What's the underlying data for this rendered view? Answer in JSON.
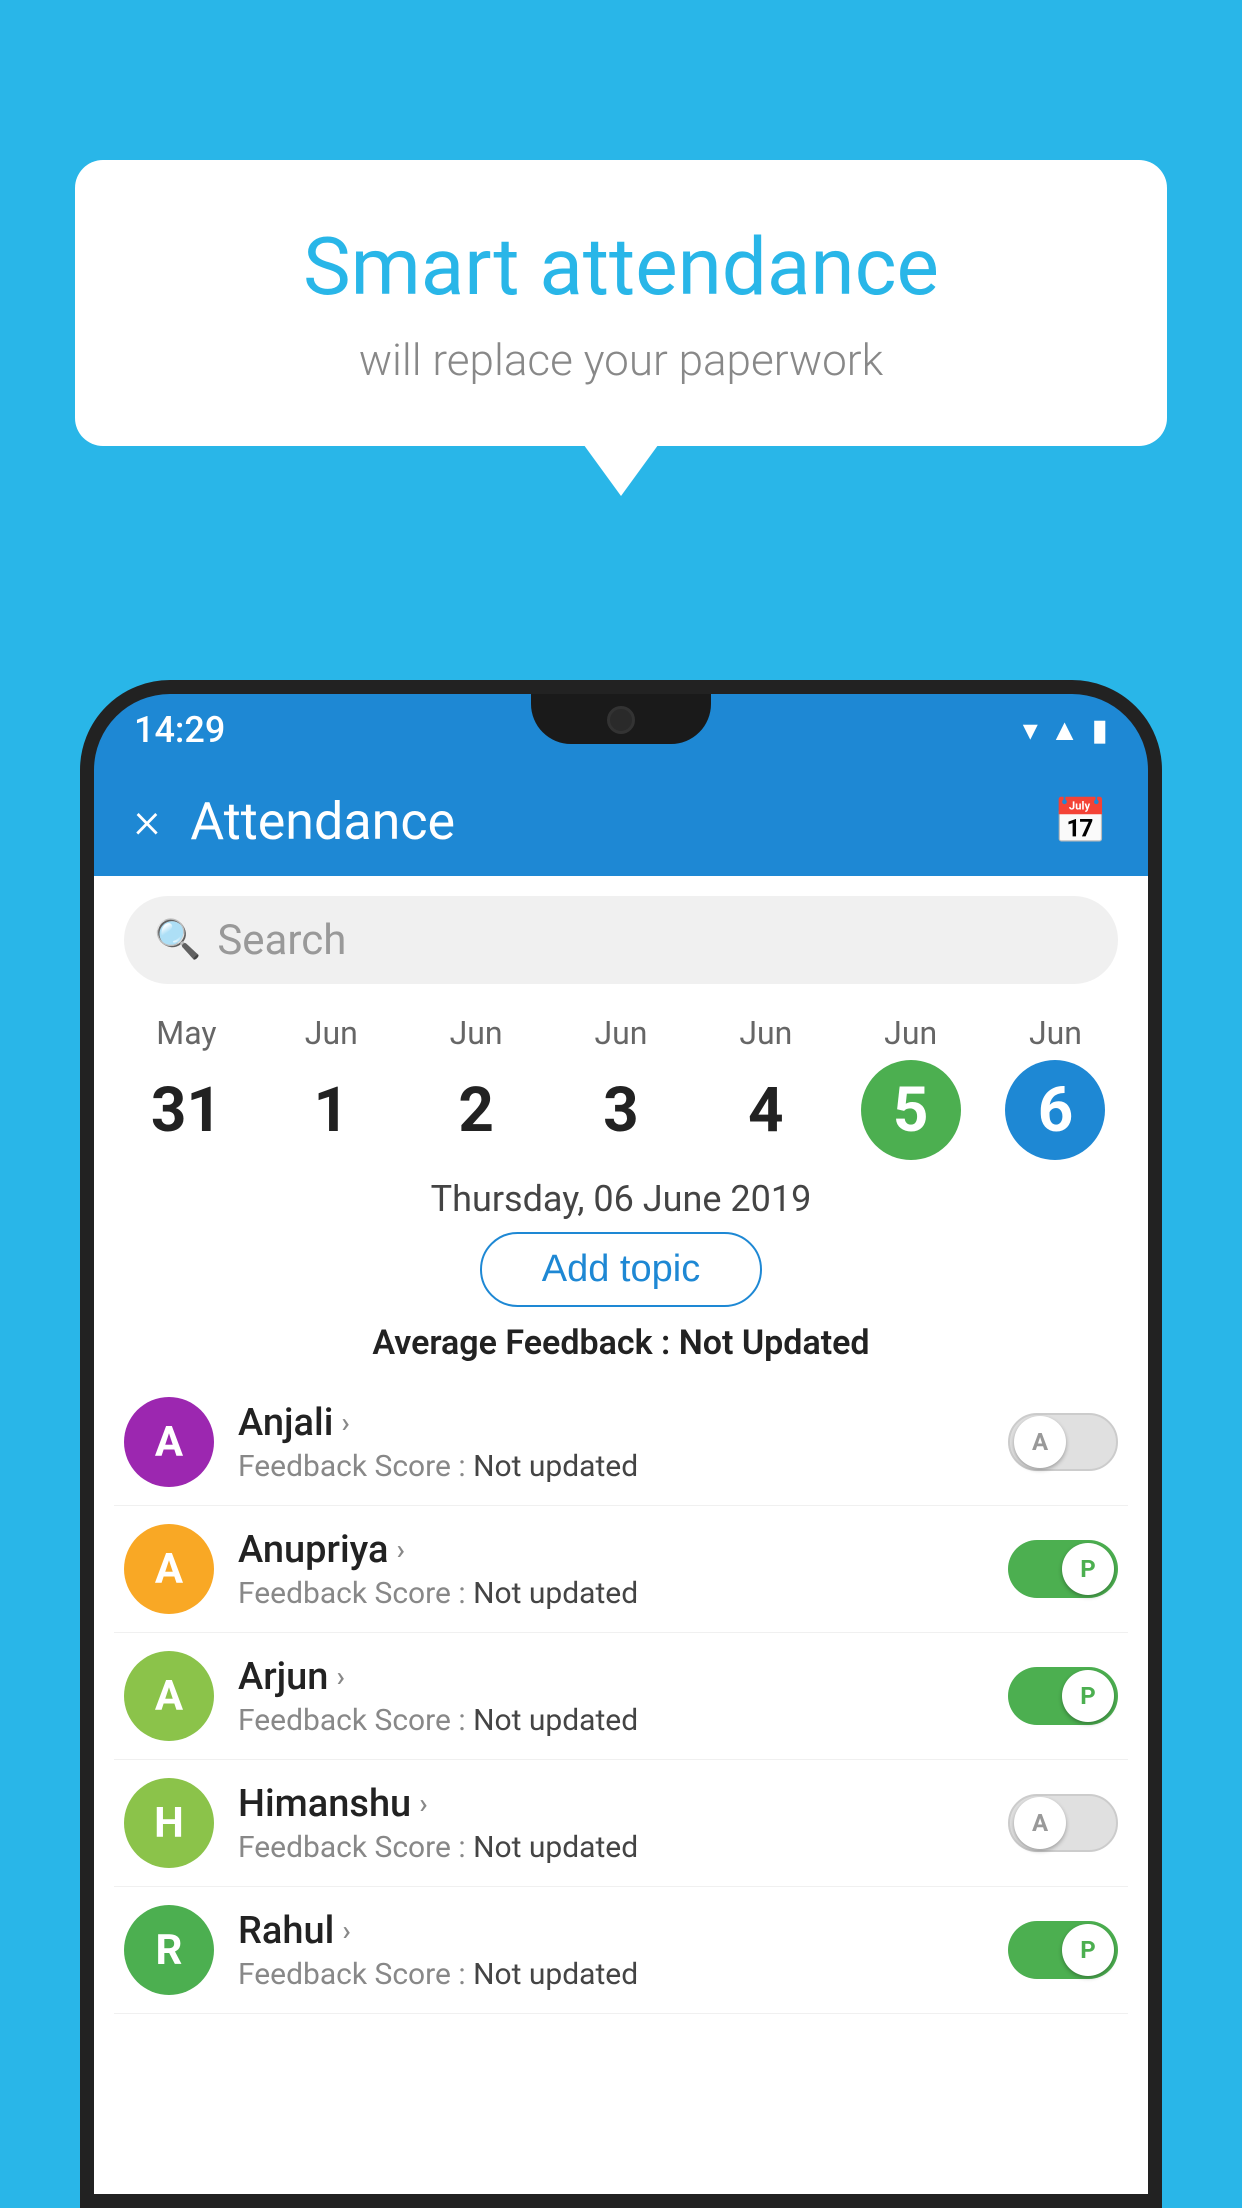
{
  "background_color": "#29b6e8",
  "speech_bubble": {
    "title": "Smart attendance",
    "subtitle": "will replace your paperwork"
  },
  "status_bar": {
    "time": "14:29",
    "icons": [
      "wifi",
      "signal",
      "battery"
    ]
  },
  "app_bar": {
    "title": "Attendance",
    "close_label": "×",
    "calendar_icon": "📅"
  },
  "search": {
    "placeholder": "Search"
  },
  "calendar": {
    "days": [
      {
        "month": "May",
        "date": "31",
        "state": "normal"
      },
      {
        "month": "Jun",
        "date": "1",
        "state": "normal"
      },
      {
        "month": "Jun",
        "date": "2",
        "state": "normal"
      },
      {
        "month": "Jun",
        "date": "3",
        "state": "normal"
      },
      {
        "month": "Jun",
        "date": "4",
        "state": "normal"
      },
      {
        "month": "Jun",
        "date": "5",
        "state": "today"
      },
      {
        "month": "Jun",
        "date": "6",
        "state": "selected"
      }
    ]
  },
  "selected_date_label": "Thursday, 06 June 2019",
  "add_topic_label": "Add topic",
  "avg_feedback_label": "Average Feedback :",
  "avg_feedback_value": "Not Updated",
  "students": [
    {
      "name": "Anjali",
      "avatar_letter": "A",
      "avatar_color": "#9c27b0",
      "feedback_label": "Feedback Score :",
      "feedback_value": "Not updated",
      "toggle_state": "off",
      "toggle_label": "A"
    },
    {
      "name": "Anupriya",
      "avatar_letter": "A",
      "avatar_color": "#f9a825",
      "feedback_label": "Feedback Score :",
      "feedback_value": "Not updated",
      "toggle_state": "on",
      "toggle_label": "P"
    },
    {
      "name": "Arjun",
      "avatar_letter": "A",
      "avatar_color": "#8bc34a",
      "feedback_label": "Feedback Score :",
      "feedback_value": "Not updated",
      "toggle_state": "on",
      "toggle_label": "P"
    },
    {
      "name": "Himanshu",
      "avatar_letter": "H",
      "avatar_color": "#8bc34a",
      "feedback_label": "Feedback Score :",
      "feedback_value": "Not updated",
      "toggle_state": "off",
      "toggle_label": "A"
    },
    {
      "name": "Rahul",
      "avatar_letter": "R",
      "avatar_color": "#4caf50",
      "feedback_label": "Feedback Score :",
      "feedback_value": "Not updated",
      "toggle_state": "on",
      "toggle_label": "P"
    }
  ]
}
